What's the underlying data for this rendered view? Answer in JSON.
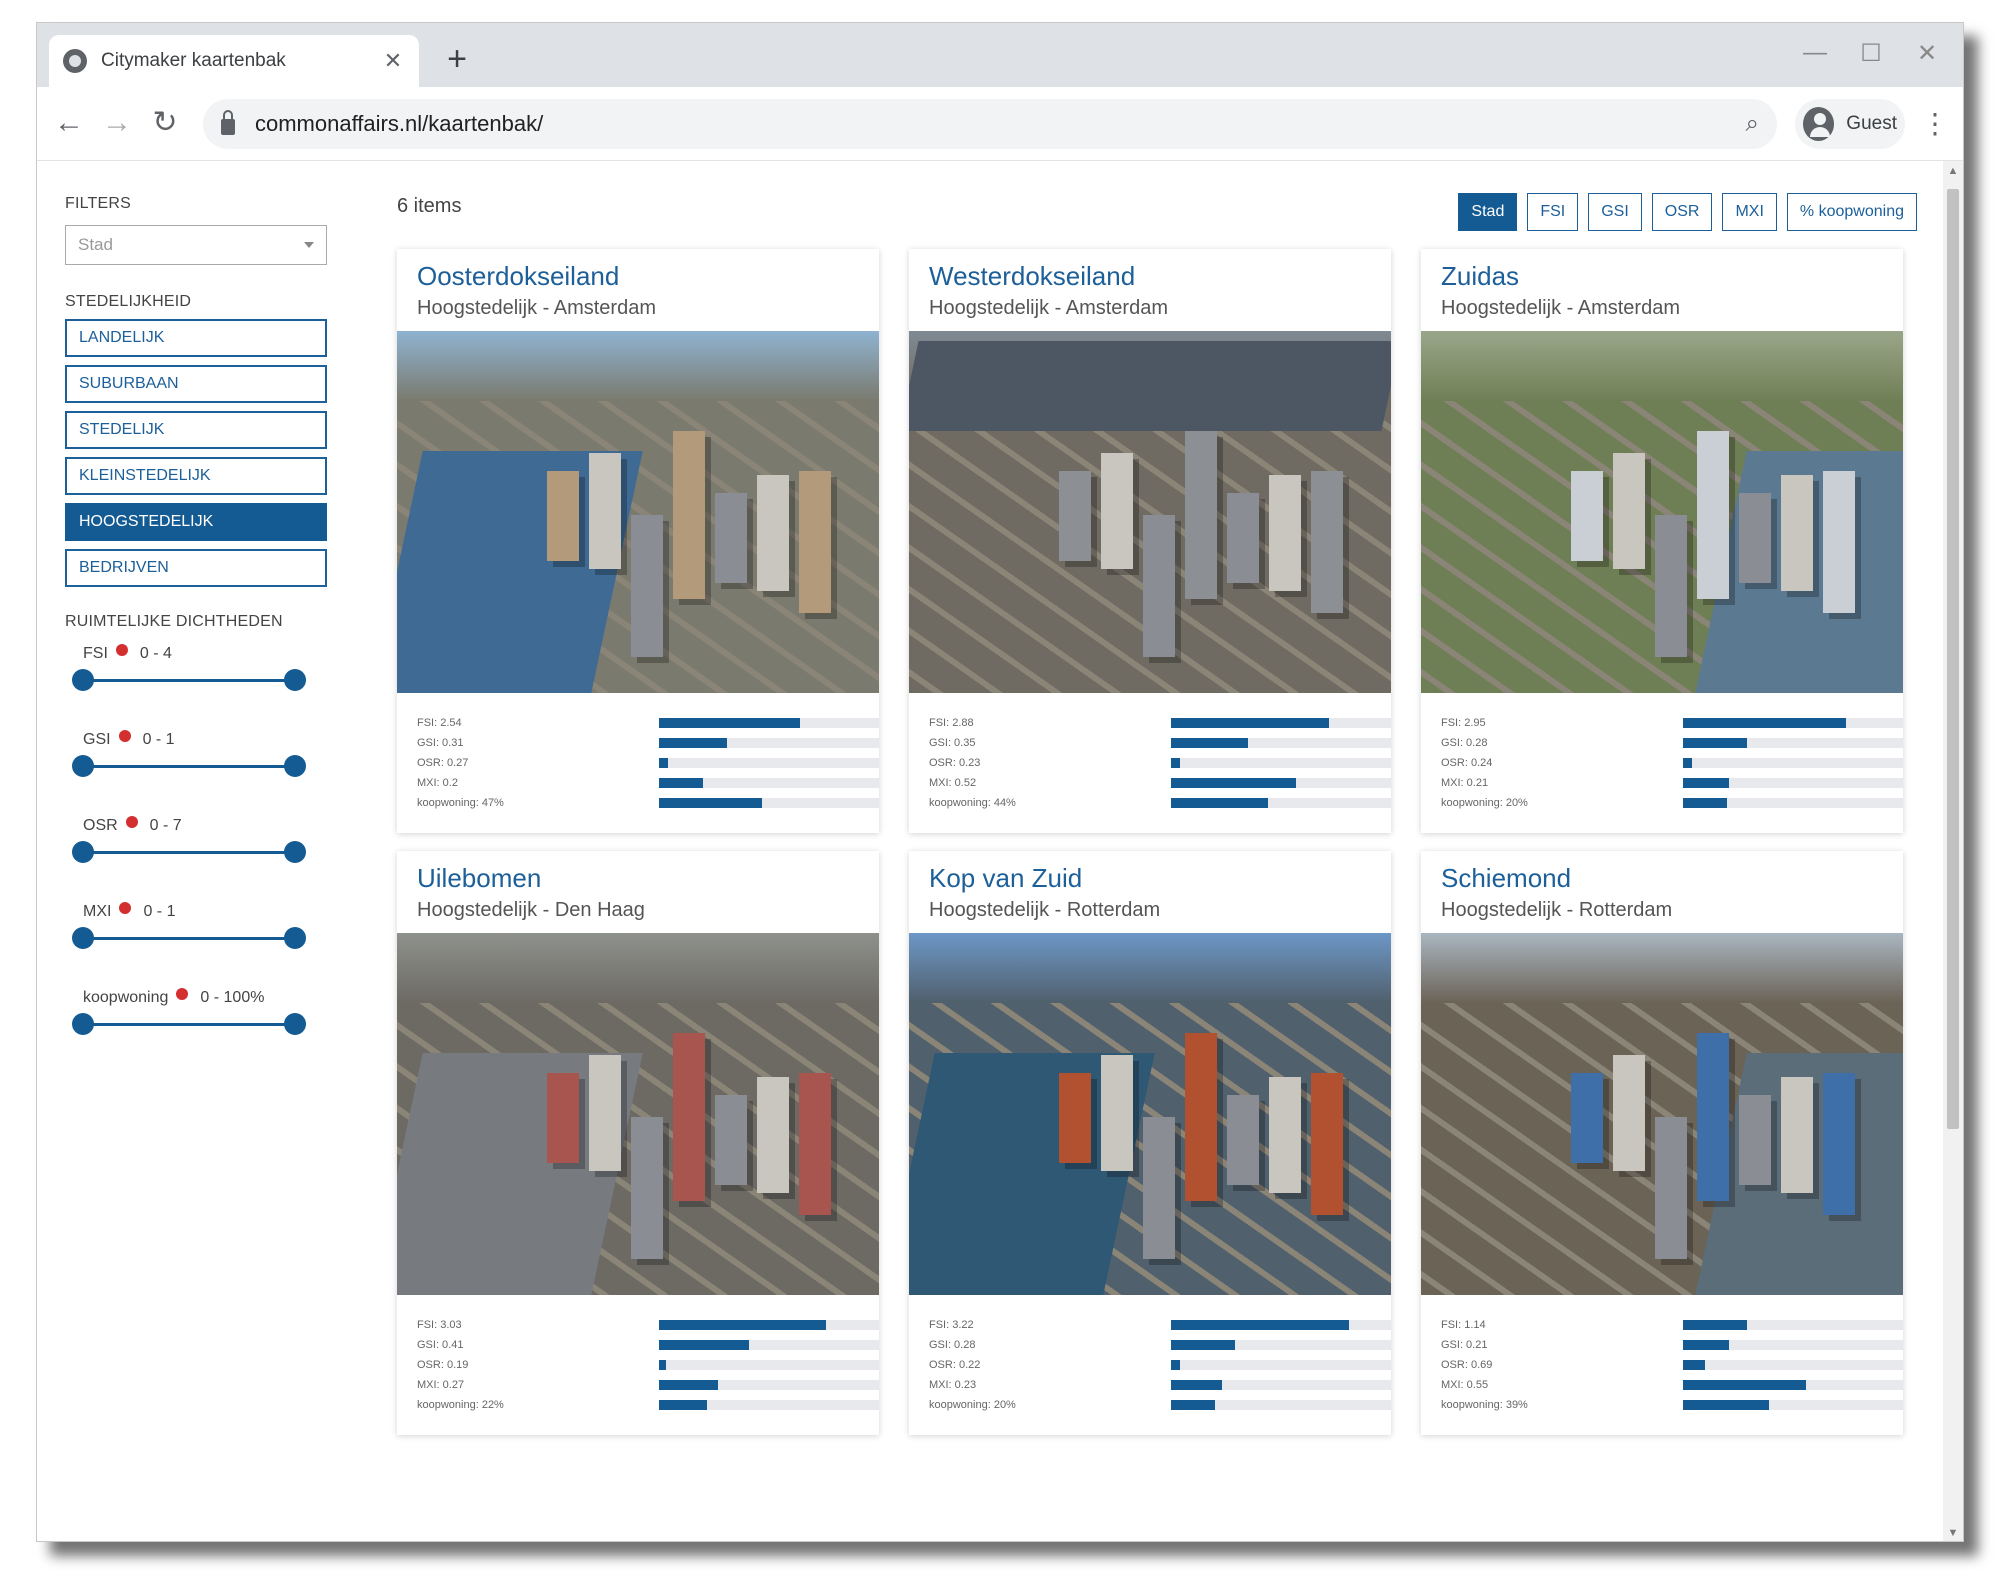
{
  "browser": {
    "tab_title": "Citymaker kaartenbak",
    "url": "commonaffairs.nl/kaartenbak/",
    "profile_label": "Guest"
  },
  "filters": {
    "heading": "FILTERS",
    "select_placeholder": "Stad",
    "urbanity_heading": "STEDELIJKHEID",
    "categories": [
      {
        "label": "LANDELIJK",
        "active": false
      },
      {
        "label": "SUBURBAAN",
        "active": false
      },
      {
        "label": "STEDELIJK",
        "active": false
      },
      {
        "label": "KLEINSTEDELIJK",
        "active": false
      },
      {
        "label": "HOOGSTEDELIJK",
        "active": true
      },
      {
        "label": "BEDRIJVEN",
        "active": false
      }
    ],
    "density_heading": "RUIMTELIJKE DICHTHEDEN",
    "sliders": [
      {
        "label": "FSI",
        "range": "0 - 4",
        "min": 0,
        "max": 1
      },
      {
        "label": "GSI",
        "range": "0 - 1",
        "min": 0,
        "max": 1
      },
      {
        "label": "OSR",
        "range": "0 - 7",
        "min": 0,
        "max": 1
      },
      {
        "label": "MXI",
        "range": "0 - 1",
        "min": 0,
        "max": 1
      },
      {
        "label": "koopwoning",
        "range": "0 - 100%",
        "min": 0,
        "max": 1
      }
    ]
  },
  "main": {
    "count": "6 items",
    "sort_buttons": [
      {
        "label": "Stad",
        "active": true
      },
      {
        "label": "FSI",
        "active": false
      },
      {
        "label": "GSI",
        "active": false
      },
      {
        "label": "OSR",
        "active": false
      },
      {
        "label": "MXI",
        "active": false
      },
      {
        "label": "% koopwoning",
        "active": false
      }
    ],
    "cards": [
      {
        "title": "Oosterdokseiland",
        "subtitle": "Hoogstedelijk - Amsterdam",
        "photo": {
          "sky": "#8fb3d1",
          "ground": "#7a7a6e",
          "water": "#3f6a93",
          "accent": "#b39a7a"
        },
        "stats": [
          {
            "label": "FSI: 2.54",
            "value": 0.64
          },
          {
            "label": "GSI: 0.31",
            "value": 0.31
          },
          {
            "label": "OSR: 0.27",
            "value": 0.04
          },
          {
            "label": "MXI: 0.2",
            "value": 0.2
          },
          {
            "label": "koopwoning: 47%",
            "value": 0.47
          }
        ]
      },
      {
        "title": "Westerdokseiland",
        "subtitle": "Hoogstedelijk - Amsterdam",
        "photo": {
          "sky": "#7f8a93",
          "ground": "#6f6a62",
          "water": "#4c5763",
          "accent": "#8c8f94"
        },
        "stats": [
          {
            "label": "FSI: 2.88",
            "value": 0.72
          },
          {
            "label": "GSI: 0.35",
            "value": 0.35
          },
          {
            "label": "OSR: 0.23",
            "value": 0.04
          },
          {
            "label": "MXI: 0.52",
            "value": 0.57
          },
          {
            "label": "koopwoning: 44%",
            "value": 0.44
          }
        ]
      },
      {
        "title": "Zuidas",
        "subtitle": "Hoogstedelijk - Amsterdam",
        "photo": {
          "sky": "#9aa68a",
          "ground": "#6f7f55",
          "water": "#5b7a92",
          "accent": "#c9cfd4"
        },
        "stats": [
          {
            "label": "FSI: 2.95",
            "value": 0.74
          },
          {
            "label": "GSI: 0.28",
            "value": 0.29
          },
          {
            "label": "OSR: 0.24",
            "value": 0.04
          },
          {
            "label": "MXI: 0.21",
            "value": 0.21
          },
          {
            "label": "koopwoning: 20%",
            "value": 0.2
          }
        ]
      },
      {
        "title": "Uilebomen",
        "subtitle": "Hoogstedelijk - Den Haag",
        "photo": {
          "sky": "#8e918c",
          "ground": "#6d6a64",
          "water": "#777b80",
          "accent": "#a8554f"
        },
        "stats": [
          {
            "label": "FSI: 3.03",
            "value": 0.76
          },
          {
            "label": "GSI: 0.41",
            "value": 0.41
          },
          {
            "label": "OSR: 0.19",
            "value": 0.03
          },
          {
            "label": "MXI: 0.27",
            "value": 0.27
          },
          {
            "label": "koopwoning: 22%",
            "value": 0.22
          }
        ]
      },
      {
        "title": "Kop van Zuid",
        "subtitle": "Hoogstedelijk - Rotterdam",
        "photo": {
          "sky": "#6d97c7",
          "ground": "#50606c",
          "water": "#2f5875",
          "accent": "#b1512f"
        },
        "stats": [
          {
            "label": "FSI: 3.22",
            "value": 0.81
          },
          {
            "label": "GSI: 0.28",
            "value": 0.29
          },
          {
            "label": "OSR: 0.22",
            "value": 0.04
          },
          {
            "label": "MXI: 0.23",
            "value": 0.23
          },
          {
            "label": "koopwoning: 20%",
            "value": 0.2
          }
        ]
      },
      {
        "title": "Schiemond",
        "subtitle": "Hoogstedelijk - Rotterdam",
        "photo": {
          "sky": "#a9b6c0",
          "ground": "#6b6356",
          "water": "#5c6d7a",
          "accent": "#3f6fa8"
        },
        "stats": [
          {
            "label": "FSI: 1.14",
            "value": 0.29
          },
          {
            "label": "GSI: 0.21",
            "value": 0.21
          },
          {
            "label": "OSR: 0.69",
            "value": 0.1
          },
          {
            "label": "MXI: 0.55",
            "value": 0.56
          },
          {
            "label": "koopwoning: 39%",
            "value": 0.39
          }
        ]
      }
    ]
  }
}
